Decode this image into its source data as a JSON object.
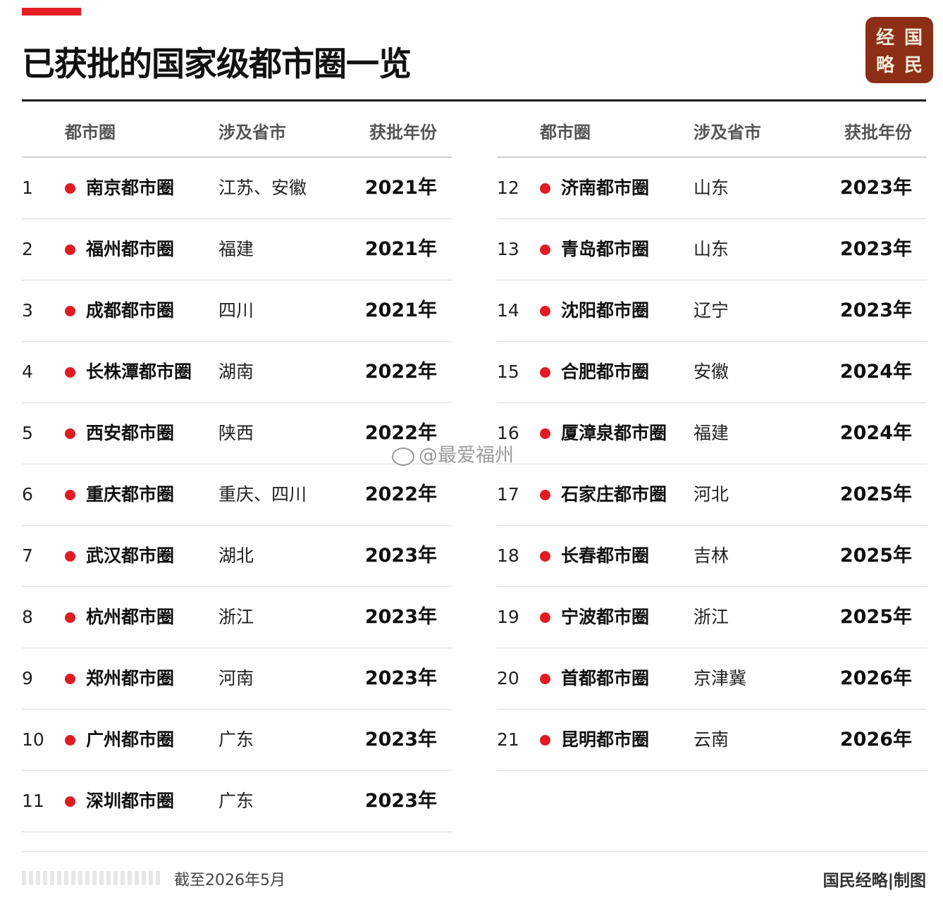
{
  "header": {
    "title": "已获批的国家级都市圈一览",
    "logo_chars": [
      "经",
      "国",
      "略",
      "民"
    ]
  },
  "table": {
    "columns": [
      "都市圈",
      "涉及省市",
      "获批年份"
    ],
    "left_rows": [
      {
        "index": "1",
        "name": "南京都市圈",
        "provinces": "江苏、安徽",
        "year": "2021年"
      },
      {
        "index": "2",
        "name": "福州都市圈",
        "provinces": "福建",
        "year": "2021年"
      },
      {
        "index": "3",
        "name": "成都都市圈",
        "provinces": "四川",
        "year": "2021年"
      },
      {
        "index": "4",
        "name": "长株潭都市圈",
        "provinces": "湖南",
        "year": "2022年"
      },
      {
        "index": "5",
        "name": "西安都市圈",
        "provinces": "陕西",
        "year": "2022年"
      },
      {
        "index": "6",
        "name": "重庆都市圈",
        "provinces": "重庆、四川",
        "year": "2022年"
      },
      {
        "index": "7",
        "name": "武汉都市圈",
        "provinces": "湖北",
        "year": "2023年"
      },
      {
        "index": "8",
        "name": "杭州都市圈",
        "provinces": "浙江",
        "year": "2023年"
      },
      {
        "index": "9",
        "name": "郑州都市圈",
        "provinces": "河南",
        "year": "2023年"
      },
      {
        "index": "10",
        "name": "广州都市圈",
        "provinces": "广东",
        "year": "2023年"
      },
      {
        "index": "11",
        "name": "深圳都市圈",
        "provinces": "广东",
        "year": "2023年"
      }
    ],
    "right_rows": [
      {
        "index": "12",
        "name": "济南都市圈",
        "provinces": "山东",
        "year": "2023年"
      },
      {
        "index": "13",
        "name": "青岛都市圈",
        "provinces": "山东",
        "year": "2023年"
      },
      {
        "index": "14",
        "name": "沈阳都市圈",
        "provinces": "辽宁",
        "year": "2023年"
      },
      {
        "index": "15",
        "name": "合肥都市圈",
        "provinces": "安徽",
        "year": "2024年"
      },
      {
        "index": "16",
        "name": "厦漳泉都市圈",
        "provinces": "福建",
        "year": "2024年"
      },
      {
        "index": "17",
        "name": "石家庄都市圈",
        "provinces": "河北",
        "year": "2025年"
      },
      {
        "index": "18",
        "name": "长春都市圈",
        "provinces": "吉林",
        "year": "2025年"
      },
      {
        "index": "19",
        "name": "宁波都市圈",
        "provinces": "浙江",
        "year": "2025年"
      },
      {
        "index": "20",
        "name": "首都都市圈",
        "provinces": "京津冀",
        "year": "2026年"
      },
      {
        "index": "21",
        "name": "昆明都市圈",
        "provinces": "云南",
        "year": "2026年"
      }
    ]
  },
  "watermark": "@最爱福州",
  "footer": {
    "date_note": "截至2026年5月",
    "credit": "国民经略|制图"
  },
  "colors": {
    "accent": "#e31e24",
    "logo_bg": "#8c2f16",
    "dot": "#e01b22"
  }
}
